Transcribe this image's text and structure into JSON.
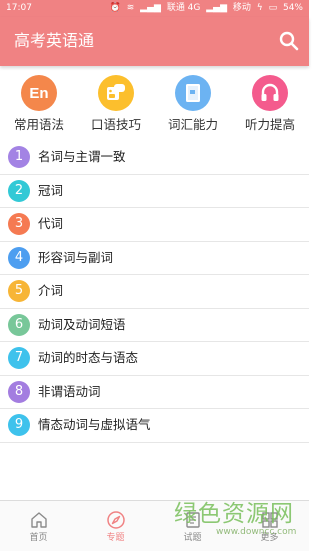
{
  "status_bar": {
    "time": "17:07",
    "carrier1": "联通 4G",
    "carrier2": "移动",
    "battery": "54%"
  },
  "app_bar": {
    "title": "高考英语通",
    "icon": "search-icon"
  },
  "categories": [
    {
      "label": "常用语法",
      "icon": "En",
      "color": "#f4874b"
    },
    {
      "label": "口语技巧",
      "icon": "speech-bubble-icon",
      "color": "#fcbf2d"
    },
    {
      "label": "词汇能力",
      "icon": "book-icon",
      "color": "#6cb3f2"
    },
    {
      "label": "听力提高",
      "icon": "headphones-icon",
      "color": "#f45b8d"
    }
  ],
  "topics": [
    {
      "num": "1",
      "title": "名词与主谓一致",
      "color": "#a383e4"
    },
    {
      "num": "2",
      "title": "冠词",
      "color": "#32c9d6"
    },
    {
      "num": "3",
      "title": "代词",
      "color": "#f57a52"
    },
    {
      "num": "4",
      "title": "形容词与副词",
      "color": "#4d9ef0"
    },
    {
      "num": "5",
      "title": "介词",
      "color": "#f7b536"
    },
    {
      "num": "6",
      "title": "动词及动词短语",
      "color": "#78c799"
    },
    {
      "num": "7",
      "title": "动词的时态与语态",
      "color": "#3ec2ec"
    },
    {
      "num": "8",
      "title": "非谓语动词",
      "color": "#a37de0"
    },
    {
      "num": "9",
      "title": "情态动词与虚拟语气",
      "color": "#3ec2ec"
    }
  ],
  "bottom_nav": [
    {
      "label": "首页",
      "icon": "home-icon",
      "active": false
    },
    {
      "label": "专题",
      "icon": "compass-icon",
      "active": true
    },
    {
      "label": "试题",
      "icon": "quiz-icon",
      "active": false
    },
    {
      "label": "更多",
      "icon": "grid-icon",
      "active": false
    }
  ],
  "watermark": {
    "main": "绿色资源网",
    "sub": "www.downcc.com"
  },
  "colors": {
    "accent": "#f08283",
    "divider": "#e6e6e6"
  }
}
